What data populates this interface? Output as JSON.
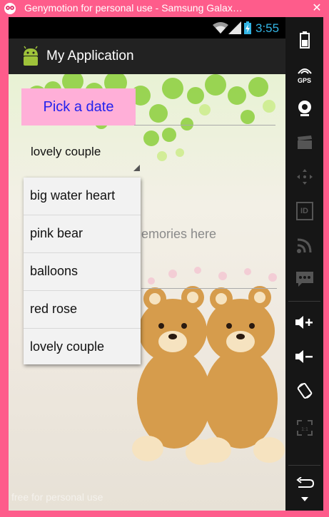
{
  "window": {
    "title": "Genymotion for personal use - Samsung Galax…",
    "close_glyph": "✕"
  },
  "status_bar": {
    "time": "3:55",
    "accent_color": "#33b5e5"
  },
  "action_bar": {
    "title": "My Application"
  },
  "form": {
    "pick_date_label": "Pick a date",
    "spinner_selected": "lovely couple",
    "memories_hint": "emories here"
  },
  "dropdown": {
    "items": [
      "big water heart",
      "pink bear",
      "balloons",
      "red rose",
      "lovely couple"
    ]
  },
  "watermark": "free for personal use",
  "toolbar": {
    "gps_label": "GPS",
    "id_label": "ID",
    "icons": [
      "battery-icon",
      "gps-icon",
      "webcam-icon",
      "clapperboard-icon",
      "dpad-icon",
      "id-icon",
      "cast-icon",
      "sms-icon",
      "volume-up-icon",
      "volume-down-icon",
      "rotate-icon",
      "fullscreen-icon",
      "back-icon"
    ]
  },
  "colors": {
    "frame": "#fe5c8b",
    "pick_button_bg": "#ffafd8",
    "pick_button_text": "#2222ee"
  }
}
